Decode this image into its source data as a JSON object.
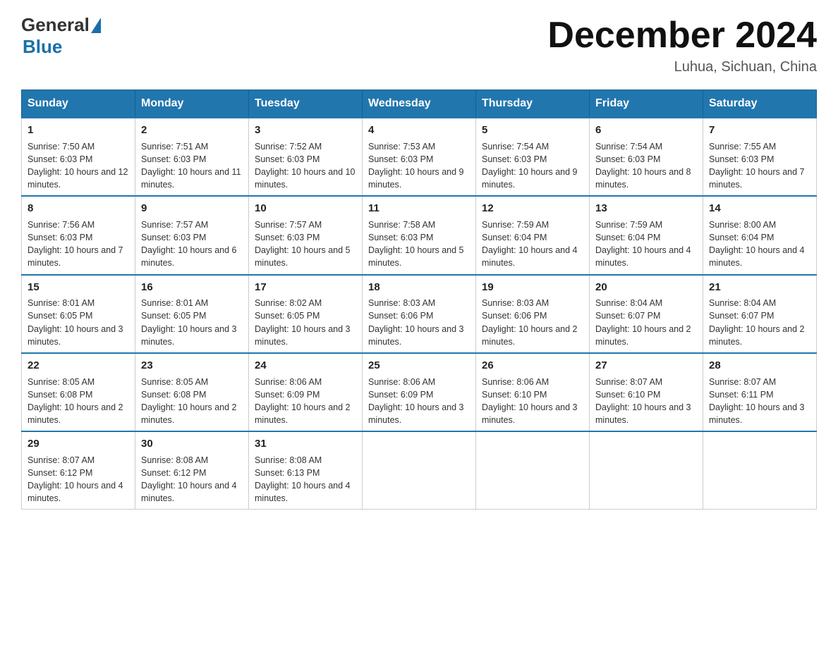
{
  "header": {
    "logo_general": "General",
    "logo_blue": "Blue",
    "month_title": "December 2024",
    "location": "Luhua, Sichuan, China"
  },
  "weekdays": [
    "Sunday",
    "Monday",
    "Tuesday",
    "Wednesday",
    "Thursday",
    "Friday",
    "Saturday"
  ],
  "weeks": [
    [
      {
        "day": "1",
        "sunrise": "7:50 AM",
        "sunset": "6:03 PM",
        "daylight": "10 hours and 12 minutes."
      },
      {
        "day": "2",
        "sunrise": "7:51 AM",
        "sunset": "6:03 PM",
        "daylight": "10 hours and 11 minutes."
      },
      {
        "day": "3",
        "sunrise": "7:52 AM",
        "sunset": "6:03 PM",
        "daylight": "10 hours and 10 minutes."
      },
      {
        "day": "4",
        "sunrise": "7:53 AM",
        "sunset": "6:03 PM",
        "daylight": "10 hours and 9 minutes."
      },
      {
        "day": "5",
        "sunrise": "7:54 AM",
        "sunset": "6:03 PM",
        "daylight": "10 hours and 9 minutes."
      },
      {
        "day": "6",
        "sunrise": "7:54 AM",
        "sunset": "6:03 PM",
        "daylight": "10 hours and 8 minutes."
      },
      {
        "day": "7",
        "sunrise": "7:55 AM",
        "sunset": "6:03 PM",
        "daylight": "10 hours and 7 minutes."
      }
    ],
    [
      {
        "day": "8",
        "sunrise": "7:56 AM",
        "sunset": "6:03 PM",
        "daylight": "10 hours and 7 minutes."
      },
      {
        "day": "9",
        "sunrise": "7:57 AM",
        "sunset": "6:03 PM",
        "daylight": "10 hours and 6 minutes."
      },
      {
        "day": "10",
        "sunrise": "7:57 AM",
        "sunset": "6:03 PM",
        "daylight": "10 hours and 5 minutes."
      },
      {
        "day": "11",
        "sunrise": "7:58 AM",
        "sunset": "6:03 PM",
        "daylight": "10 hours and 5 minutes."
      },
      {
        "day": "12",
        "sunrise": "7:59 AM",
        "sunset": "6:04 PM",
        "daylight": "10 hours and 4 minutes."
      },
      {
        "day": "13",
        "sunrise": "7:59 AM",
        "sunset": "6:04 PM",
        "daylight": "10 hours and 4 minutes."
      },
      {
        "day": "14",
        "sunrise": "8:00 AM",
        "sunset": "6:04 PM",
        "daylight": "10 hours and 4 minutes."
      }
    ],
    [
      {
        "day": "15",
        "sunrise": "8:01 AM",
        "sunset": "6:05 PM",
        "daylight": "10 hours and 3 minutes."
      },
      {
        "day": "16",
        "sunrise": "8:01 AM",
        "sunset": "6:05 PM",
        "daylight": "10 hours and 3 minutes."
      },
      {
        "day": "17",
        "sunrise": "8:02 AM",
        "sunset": "6:05 PM",
        "daylight": "10 hours and 3 minutes."
      },
      {
        "day": "18",
        "sunrise": "8:03 AM",
        "sunset": "6:06 PM",
        "daylight": "10 hours and 3 minutes."
      },
      {
        "day": "19",
        "sunrise": "8:03 AM",
        "sunset": "6:06 PM",
        "daylight": "10 hours and 2 minutes."
      },
      {
        "day": "20",
        "sunrise": "8:04 AM",
        "sunset": "6:07 PM",
        "daylight": "10 hours and 2 minutes."
      },
      {
        "day": "21",
        "sunrise": "8:04 AM",
        "sunset": "6:07 PM",
        "daylight": "10 hours and 2 minutes."
      }
    ],
    [
      {
        "day": "22",
        "sunrise": "8:05 AM",
        "sunset": "6:08 PM",
        "daylight": "10 hours and 2 minutes."
      },
      {
        "day": "23",
        "sunrise": "8:05 AM",
        "sunset": "6:08 PM",
        "daylight": "10 hours and 2 minutes."
      },
      {
        "day": "24",
        "sunrise": "8:06 AM",
        "sunset": "6:09 PM",
        "daylight": "10 hours and 2 minutes."
      },
      {
        "day": "25",
        "sunrise": "8:06 AM",
        "sunset": "6:09 PM",
        "daylight": "10 hours and 3 minutes."
      },
      {
        "day": "26",
        "sunrise": "8:06 AM",
        "sunset": "6:10 PM",
        "daylight": "10 hours and 3 minutes."
      },
      {
        "day": "27",
        "sunrise": "8:07 AM",
        "sunset": "6:10 PM",
        "daylight": "10 hours and 3 minutes."
      },
      {
        "day": "28",
        "sunrise": "8:07 AM",
        "sunset": "6:11 PM",
        "daylight": "10 hours and 3 minutes."
      }
    ],
    [
      {
        "day": "29",
        "sunrise": "8:07 AM",
        "sunset": "6:12 PM",
        "daylight": "10 hours and 4 minutes."
      },
      {
        "day": "30",
        "sunrise": "8:08 AM",
        "sunset": "6:12 PM",
        "daylight": "10 hours and 4 minutes."
      },
      {
        "day": "31",
        "sunrise": "8:08 AM",
        "sunset": "6:13 PM",
        "daylight": "10 hours and 4 minutes."
      },
      null,
      null,
      null,
      null
    ]
  ]
}
